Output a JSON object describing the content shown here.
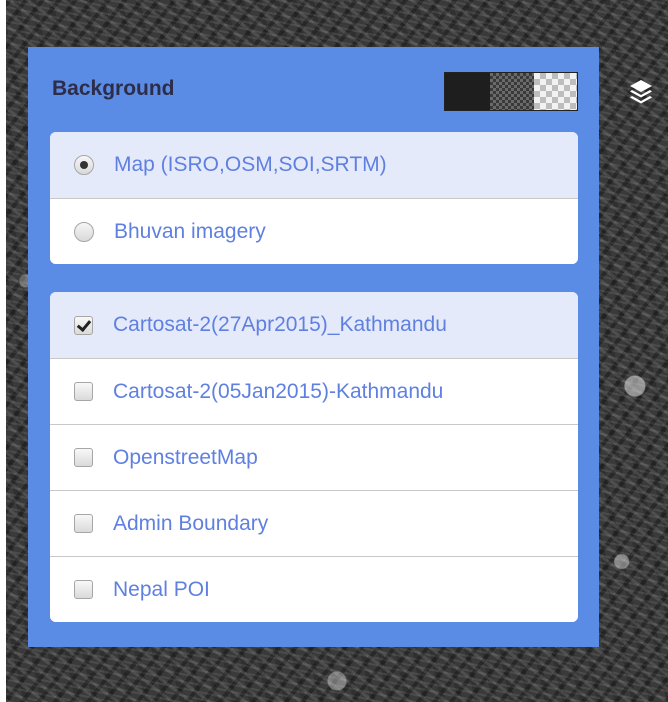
{
  "icons": {
    "layers_toggle": "layers-icon"
  },
  "colors": {
    "panel_background": "#5a8ce6",
    "label_text": "#5f80e0",
    "title_text": "#2d2d4a",
    "active_row": "#e5eafb"
  },
  "panel": {
    "title": "Background",
    "opacity_levels": [
      "opaque",
      "semi-transparent",
      "transparent"
    ],
    "selected_opacity": "opaque"
  },
  "base_layers": [
    {
      "label": "Map (ISRO,OSM,SOI,SRTM)",
      "selected": true
    },
    {
      "label": "Bhuvan imagery",
      "selected": false
    }
  ],
  "overlay_layers": [
    {
      "label": "Cartosat-2(27Apr2015)_Kathmandu",
      "checked": true
    },
    {
      "label": "Cartosat-2(05Jan2015)-Kathmandu",
      "checked": false
    },
    {
      "label": "OpenstreetMap",
      "checked": false
    },
    {
      "label": "Admin Boundary",
      "checked": false
    },
    {
      "label": "Nepal POI",
      "checked": false
    }
  ]
}
